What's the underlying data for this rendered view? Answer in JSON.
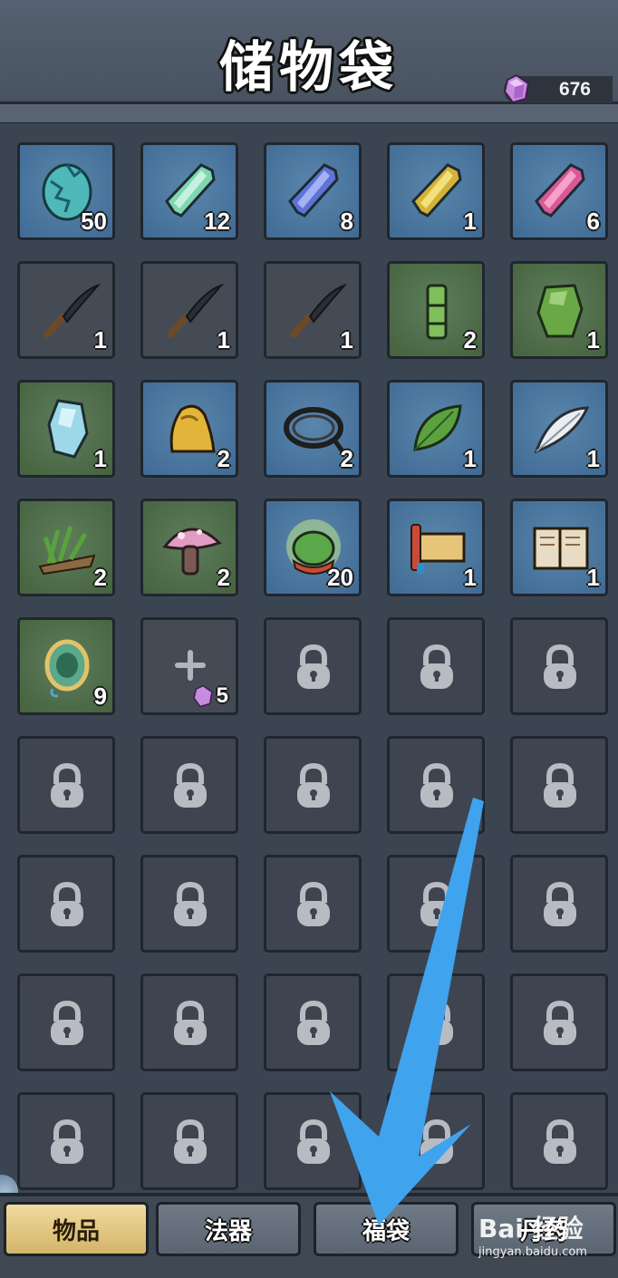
{
  "header": {
    "title": "储物袋",
    "currency_value": "676",
    "currency_icon": "purple-gem-icon"
  },
  "colors": {
    "slot_blue": "#4a77a0",
    "slot_green": "#52704c",
    "slot_locked": "#3e4550",
    "tab_active": "#e3c786",
    "arrow": "#3fa3ee"
  },
  "grid": {
    "slots": [
      {
        "icon": "cracked-egg-icon",
        "qty": "50",
        "bg": "blue"
      },
      {
        "icon": "green-crystal-icon",
        "qty": "12",
        "bg": "blue"
      },
      {
        "icon": "blue-crystal-icon",
        "qty": "8",
        "bg": "blue"
      },
      {
        "icon": "gold-crystal-icon",
        "qty": "1",
        "bg": "blue"
      },
      {
        "icon": "pink-crystal-icon",
        "qty": "6",
        "bg": "blue"
      },
      {
        "icon": "sickle-icon",
        "qty": "1",
        "bg": "dark"
      },
      {
        "icon": "sickle-icon",
        "qty": "1",
        "bg": "dark"
      },
      {
        "icon": "sickle-icon",
        "qty": "1",
        "bg": "dark"
      },
      {
        "icon": "bamboo-icon",
        "qty": "2",
        "bg": "green"
      },
      {
        "icon": "jade-stone-icon",
        "qty": "1",
        "bg": "green"
      },
      {
        "icon": "ice-crystal-icon",
        "qty": "1",
        "bg": "green"
      },
      {
        "icon": "gold-ore-icon",
        "qty": "2",
        "bg": "blue"
      },
      {
        "icon": "rope-coil-icon",
        "qty": "2",
        "bg": "blue"
      },
      {
        "icon": "leaf-icon",
        "qty": "1",
        "bg": "blue"
      },
      {
        "icon": "feather-icon",
        "qty": "1",
        "bg": "blue"
      },
      {
        "icon": "herb-bundle-icon",
        "qty": "2",
        "bg": "green"
      },
      {
        "icon": "mushroom-icon",
        "qty": "2",
        "bg": "green"
      },
      {
        "icon": "glowing-token-icon",
        "qty": "20",
        "bg": "blue"
      },
      {
        "icon": "scroll-icon",
        "qty": "1",
        "bg": "blue"
      },
      {
        "icon": "book-icon",
        "qty": "1",
        "bg": "blue"
      },
      {
        "icon": "jade-pendant-icon",
        "qty": "9",
        "bg": "green"
      },
      {
        "icon": "unlock-slot",
        "qty": "",
        "bg": "dark",
        "cost": "5"
      }
    ],
    "locked_count": 23
  },
  "tabs": [
    {
      "label": "物品",
      "active": true
    },
    {
      "label": "法器",
      "active": false
    },
    {
      "label": "福袋",
      "active": false
    },
    {
      "label": "丹药",
      "active": false
    }
  ],
  "watermark": {
    "brand": "Bai 经验",
    "url": "jingyan.baidu.com"
  }
}
